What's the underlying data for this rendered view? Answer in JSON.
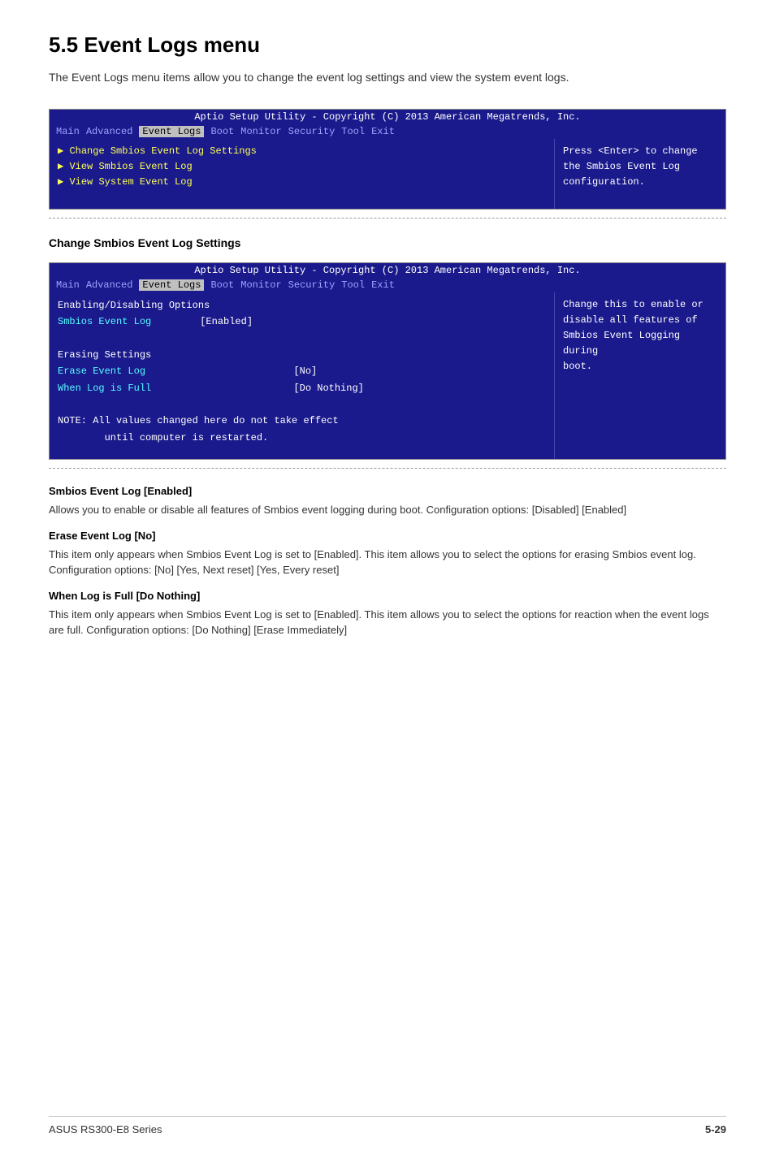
{
  "page": {
    "title": "5.5    Event Logs menu",
    "intro": "The Event Logs menu items allow you to change the event log settings and view the system event logs."
  },
  "bios1": {
    "header": "Aptio Setup Utility - Copyright (C) 2013 American Megatrends, Inc.",
    "nav_items": [
      "Main",
      "Advanced",
      "Event Logs",
      "Boot",
      "Monitor",
      "Security",
      "Tool",
      "Exit"
    ],
    "active_nav": "Event Logs",
    "menu_items": [
      "Change Smbios Event Log Settings",
      "View Smbios Event Log",
      "View System Event Log"
    ],
    "help_text": "Press <Enter> to change\nthe Smbios Event Log\nconfiguration."
  },
  "section1_title": "Change Smbios Event Log Settings",
  "bios2": {
    "header": "Aptio Setup Utility - Copyright (C) 2013 American Megatrends, Inc.",
    "nav_items": [
      "Main",
      "Advanced",
      "Event Logs",
      "Boot",
      "Monitor",
      "Security",
      "Tool",
      "Exit"
    ],
    "active_nav": "Event Logs",
    "rows": [
      {
        "label": "Enabling/Disabling Options",
        "value": ""
      },
      {
        "label": "Smbios Event Log",
        "value": "[Enabled]"
      },
      {
        "label": "",
        "value": ""
      },
      {
        "label": "Erasing Settings",
        "value": ""
      },
      {
        "label": "Erase Event Log",
        "value": "[No]"
      },
      {
        "label": "When Log is Full",
        "value": "[Do Nothing]"
      }
    ],
    "note": "NOTE: All values changed here do not take effect\n        until computer is restarted.",
    "help_text": "Change this to enable or\ndisable all features of\nSmbios Event Logging during\nboot."
  },
  "smbios_section": {
    "title": "Smbios Event Log [Enabled]",
    "body": "Allows you to enable or disable all features of Smbios event logging during boot.\nConfiguration options: [Disabled] [Enabled]"
  },
  "erase_section": {
    "title": "Erase Event Log [No]",
    "body": "This item only appears when Smbios Event Log is set to [Enabled]. This item allows you to select the options for erasing Smbios event log. Configuration options: [No] [Yes, Next reset] [Yes, Every reset]"
  },
  "whenlog_section": {
    "title": "When Log is Full [Do Nothing]",
    "body": "This item only appears when Smbios Event Log is set to [Enabled]. This item allows you to select the options for reaction when the event logs are full. Configuration options: [Do Nothing] [Erase Immediately]"
  },
  "footer": {
    "left": "ASUS RS300-E8 Series",
    "right": "5-29"
  }
}
